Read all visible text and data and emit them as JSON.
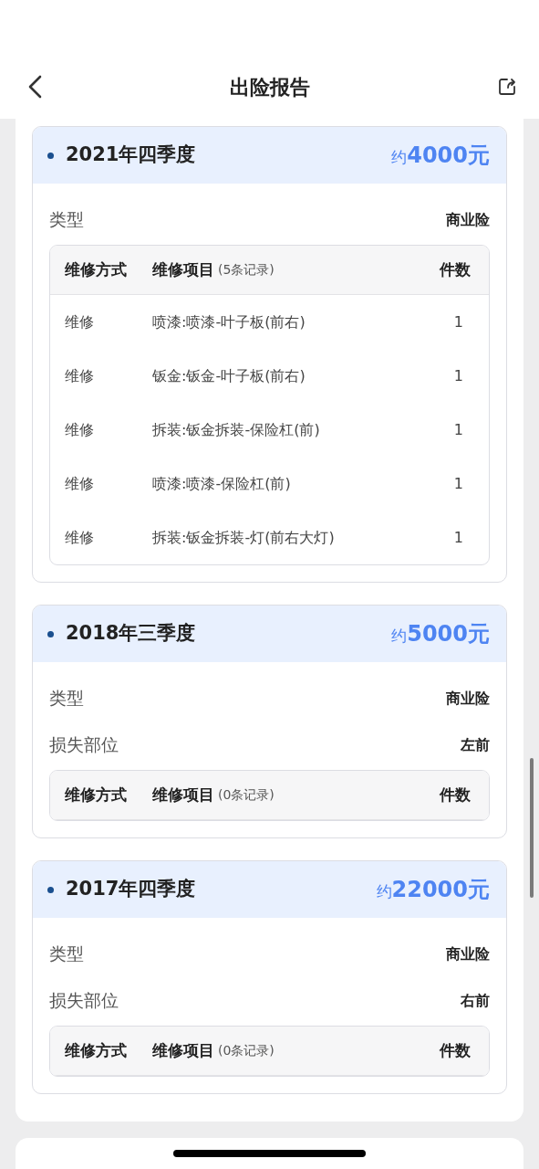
{
  "header": {
    "title": "出险报告"
  },
  "reports": [
    {
      "period": "2021年四季度",
      "amount_prefix": "约",
      "amount": "4000元",
      "fields": [
        {
          "label": "类型",
          "value": "商业险"
        }
      ],
      "table": {
        "columns": [
          "维修方式",
          "维修项目",
          "件数"
        ],
        "record_count": "(5条记录)",
        "rows": [
          {
            "method": "维修",
            "item": "喷漆:喷漆-叶子板(前右)",
            "count": "1"
          },
          {
            "method": "维修",
            "item": "钣金:钣金-叶子板(前右)",
            "count": "1"
          },
          {
            "method": "维修",
            "item": "拆装:钣金拆装-保险杠(前)",
            "count": "1"
          },
          {
            "method": "维修",
            "item": "喷漆:喷漆-保险杠(前)",
            "count": "1"
          },
          {
            "method": "维修",
            "item": "拆装:钣金拆装-灯(前右大灯)",
            "count": "1"
          }
        ]
      }
    },
    {
      "period": "2018年三季度",
      "amount_prefix": "约",
      "amount": "5000元",
      "fields": [
        {
          "label": "类型",
          "value": "商业险"
        },
        {
          "label": "损失部位",
          "value": "左前"
        }
      ],
      "table": {
        "columns": [
          "维修方式",
          "维修项目",
          "件数"
        ],
        "record_count": "(0条记录)"
      }
    },
    {
      "period": "2017年四季度",
      "amount_prefix": "约",
      "amount": "22000元",
      "fields": [
        {
          "label": "类型",
          "value": "商业险"
        },
        {
          "label": "损失部位",
          "value": "右前"
        }
      ],
      "table": {
        "columns": [
          "维修方式",
          "维修项目",
          "件数"
        ],
        "record_count": "(0条记录)"
      }
    }
  ]
}
